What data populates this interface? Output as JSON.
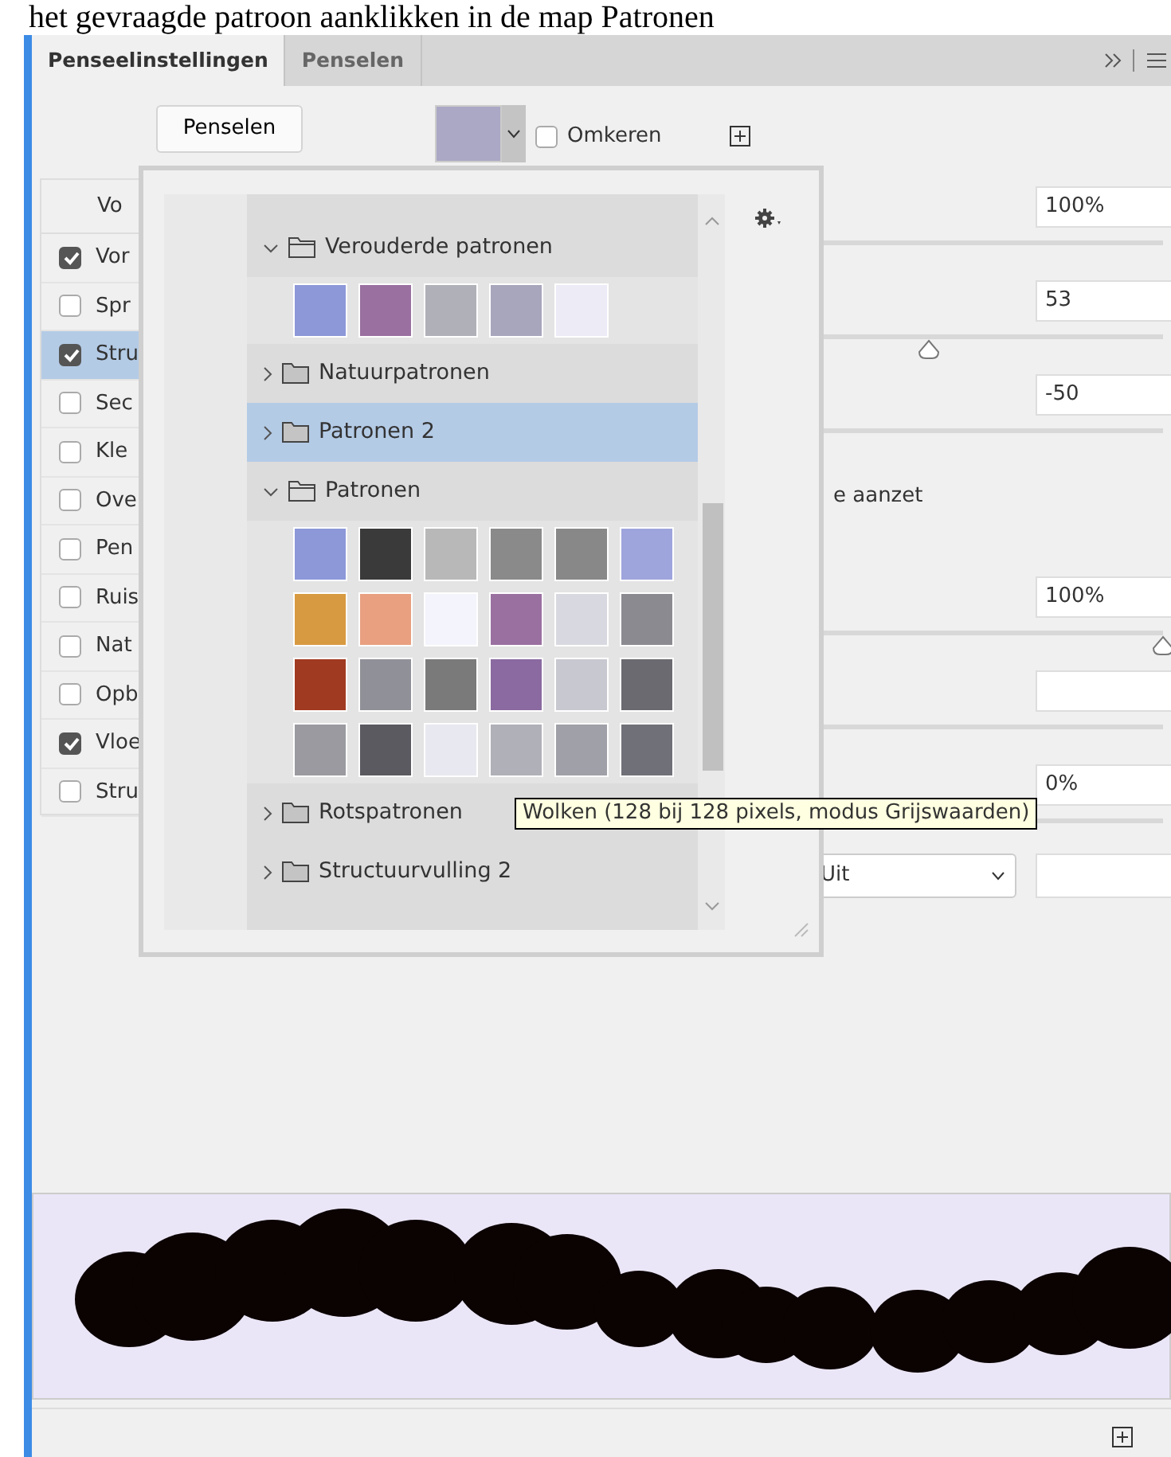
{
  "caption": "het gevraagde patroon aanklikken in de map Patronen",
  "tabs": [
    {
      "label": "Penseelinstellingen",
      "selected": true
    },
    {
      "label": "Penselen",
      "selected": false
    }
  ],
  "toolbar": {
    "brushes_button": "Penselen",
    "invert": {
      "label": "Omkeren",
      "checked": false
    }
  },
  "options": {
    "header": "Vo",
    "items": [
      {
        "label": "Vor",
        "checked": true,
        "selected": false
      },
      {
        "label": "Spr",
        "checked": false,
        "selected": false
      },
      {
        "label": "Stru",
        "checked": true,
        "selected": true
      },
      {
        "label": "Sec",
        "checked": false,
        "selected": false
      },
      {
        "label": "Kle",
        "checked": false,
        "selected": false
      },
      {
        "label": "Ove",
        "checked": false,
        "selected": false
      },
      {
        "label": "Pen",
        "checked": false,
        "selected": false
      },
      {
        "label": "Ruis",
        "checked": false,
        "selected": false
      },
      {
        "label": "Nat",
        "checked": false,
        "selected": false
      },
      {
        "label": "Opb",
        "checked": false,
        "selected": false
      },
      {
        "label": "Vloe",
        "checked": true,
        "selected": false
      },
      {
        "label": "Stru",
        "checked": false,
        "selected": false
      }
    ]
  },
  "settings": [
    {
      "kind": "field",
      "value": "100%"
    },
    {
      "kind": "field",
      "value": "53",
      "level": 0.74
    },
    {
      "kind": "field",
      "value": "-50"
    },
    {
      "kind": "text",
      "text": "e aanzet"
    },
    {
      "kind": "field",
      "value": "100%",
      "level": 1
    },
    {
      "kind": "field"
    },
    {
      "kind": "field",
      "value": "0%"
    },
    {
      "kind": "select",
      "value": "Uit"
    }
  ],
  "pattern_picker": {
    "folders": [
      {
        "name": "Verouderde patronen",
        "expanded": true,
        "selected": false,
        "swatches": [
          {
            "color": "#8c98d8"
          },
          {
            "color": "#9a70a0"
          },
          {
            "color": "#b0b0b8"
          },
          {
            "color": "#a8a6bc"
          },
          {
            "color": "#ecebf6"
          }
        ]
      },
      {
        "name": "Natuurpatronen",
        "expanded": false,
        "selected": false
      },
      {
        "name": "Patronen 2",
        "expanded": false,
        "selected": true
      },
      {
        "name": "Patronen",
        "expanded": true,
        "selected": false,
        "swatches": [
          {
            "color": "#8c98d8"
          },
          {
            "color": "#3a3a3a"
          },
          {
            "color": "#b8b8b8"
          },
          {
            "color": "#8a8a8a"
          },
          {
            "color": "#888888"
          },
          {
            "color": "#9ea4dc"
          },
          {
            "color": "#d89a40"
          },
          {
            "color": "#e8a080"
          },
          {
            "color": "#f4f4fc"
          },
          {
            "color": "#9a70a0"
          },
          {
            "color": "#d8d8e0"
          },
          {
            "color": "#8a8a90"
          },
          {
            "color": "#a03a20"
          },
          {
            "color": "#909098"
          },
          {
            "color": "#7a7a7a"
          },
          {
            "color": "#8a6aa0"
          },
          {
            "color": "#c8c8d0"
          },
          {
            "color": "#6a6a70"
          },
          {
            "color": "#9a9aa0"
          },
          {
            "color": "#5a5a60"
          },
          {
            "color": "#e8e8f0"
          },
          {
            "color": "#b0b0b8"
          },
          {
            "color": "#a0a0a8"
          },
          {
            "color": "#707078"
          }
        ]
      },
      {
        "name": "Rotspatronen",
        "expanded": false,
        "selected": false
      },
      {
        "name": "Structuurvulling 2",
        "expanded": false,
        "selected": false
      }
    ]
  },
  "tooltip": "Wolken (128 bij 128 pixels, modus Grijswaarden)"
}
